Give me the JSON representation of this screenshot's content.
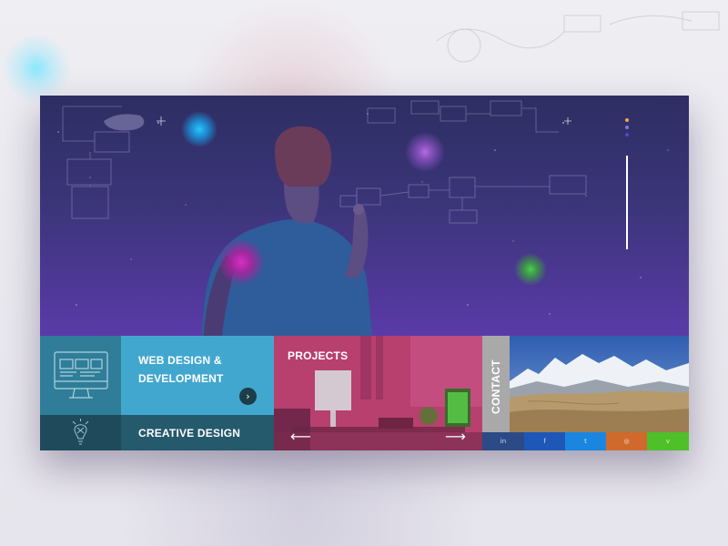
{
  "services": {
    "web_design": {
      "title": "WEB DESIGN & DEVELOPMENT",
      "icon": "monitor-layout-icon",
      "arrow": "›"
    },
    "creative_design": {
      "title": "CREATIVE DESIGN",
      "icon": "lightbulb-icon"
    }
  },
  "projects": {
    "title": "PROJECTS",
    "prev_arrow": "⟵",
    "next_arrow": "⟶"
  },
  "contact": {
    "title": "CONTACT"
  },
  "social": [
    {
      "icon": "linkedin-icon",
      "glyph": "in",
      "color": "#2c4a86"
    },
    {
      "icon": "facebook-icon",
      "glyph": "f",
      "color": "#1f57b8"
    },
    {
      "icon": "twitter-icon",
      "glyph": "t",
      "color": "#1a86e0"
    },
    {
      "icon": "instagram-icon",
      "glyph": "◎",
      "color": "#d06a2c"
    },
    {
      "icon": "vine-icon",
      "glyph": "v",
      "color": "#4fbf2a"
    }
  ],
  "colors": {
    "hero_top": "#2d2e63",
    "hero_bottom": "#5a3aa8",
    "web_tile": "#42a7cf",
    "projects_tile": "#b8406e",
    "contact_tile": "#a9a9a9"
  }
}
